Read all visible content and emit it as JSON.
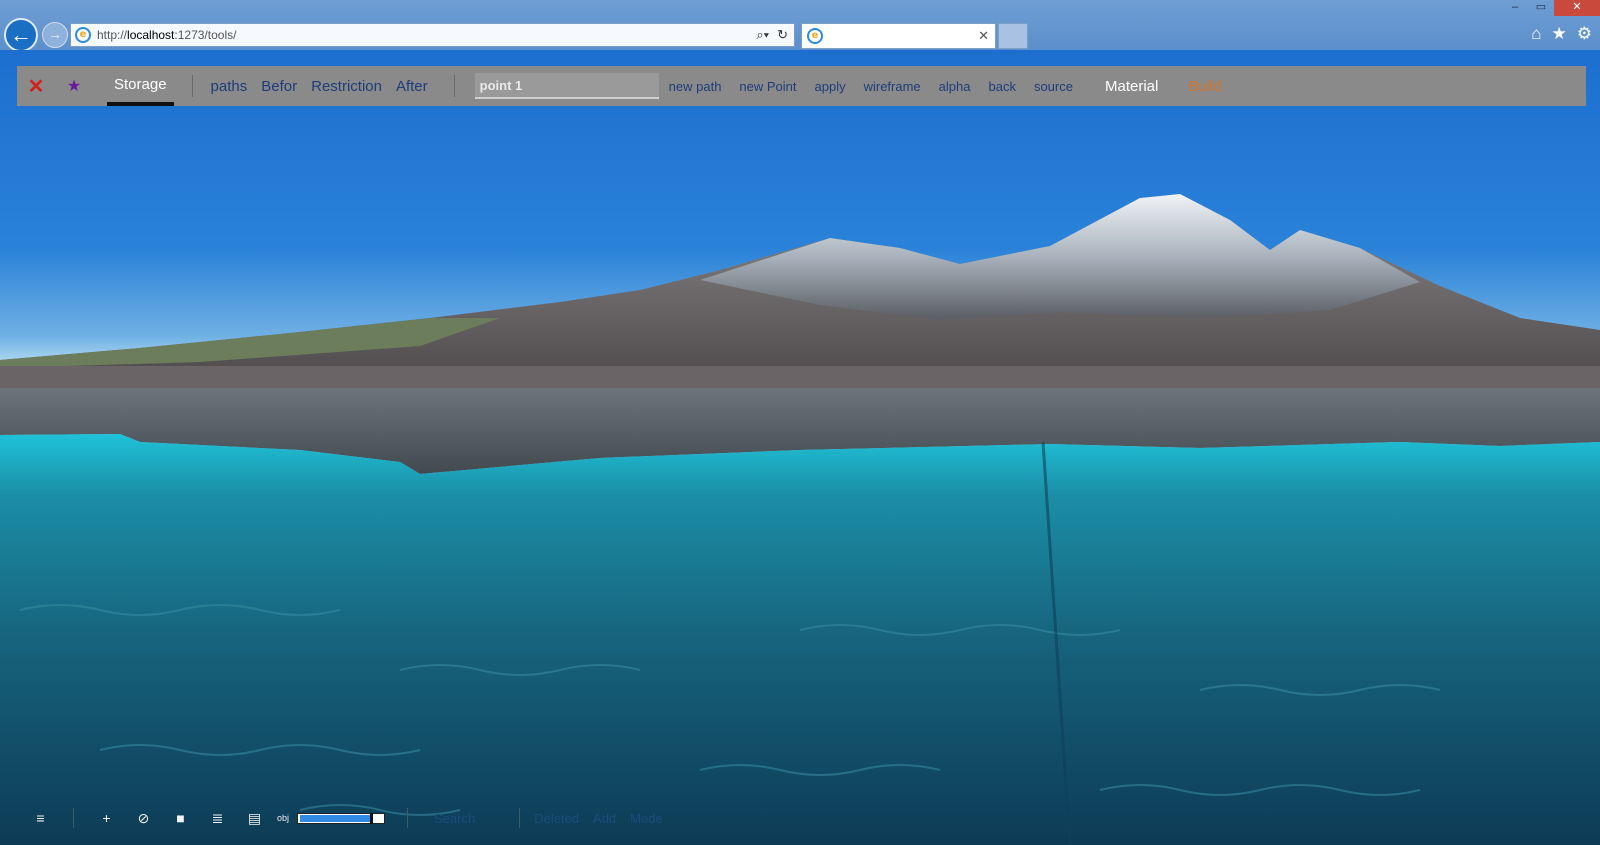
{
  "browser": {
    "url_prefix": "http://",
    "url_host": "localhost",
    "url_path": ":1273/tools/",
    "window_controls": [
      "–",
      "▭",
      "✕"
    ],
    "tab_title": "",
    "right_icons": [
      "⌂",
      "★",
      "⚙"
    ]
  },
  "toolbar": {
    "close_icon": "✕",
    "pin_icon": "★",
    "storage_label": "Storage",
    "mode_tabs": [
      "paths",
      "Befor",
      "Restriction",
      "After"
    ],
    "point_input_value": "point 1",
    "actions": [
      "new path",
      "new Point",
      "apply",
      "wireframe",
      "alpha",
      "back",
      "source"
    ],
    "material_label": "Material",
    "build_label": "Build"
  },
  "bottom": {
    "menu_icon": "≡",
    "tools": [
      "+",
      "⊘",
      "■",
      "≣",
      "▤"
    ],
    "obj_label": "obj",
    "slider_value": 0.86,
    "links": [
      "Search",
      "Deleted",
      "Add",
      "Mode"
    ]
  },
  "colors": {
    "accent_close": "#d41f1f",
    "pin": "#6a1a9c",
    "build": "#d2752a",
    "link": "#1e3d7a"
  }
}
